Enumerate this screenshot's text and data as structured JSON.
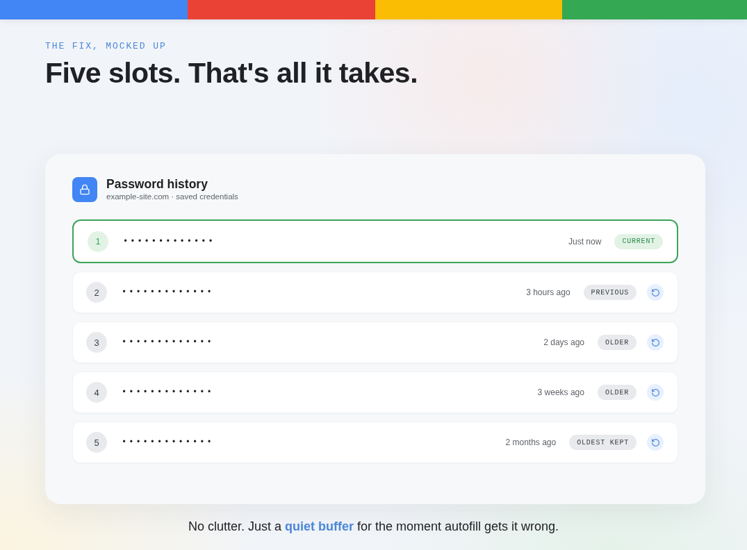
{
  "header": {
    "eyebrow": "THE FIX, MOCKED UP",
    "title": "Five slots. That's all it takes."
  },
  "card": {
    "title": "Password history",
    "subtitle": "example-site.com · saved credentials"
  },
  "rows": [
    {
      "number": "1",
      "password": "•••••••••••••",
      "time": "Just now",
      "badge": "CURRENT",
      "current": true
    },
    {
      "number": "2",
      "password": "•••••••••••••",
      "time": "3 hours ago",
      "badge": "PREVIOUS",
      "current": false
    },
    {
      "number": "3",
      "password": "•••••••••••••",
      "time": "2 days ago",
      "badge": "OLDER",
      "current": false
    },
    {
      "number": "4",
      "password": "•••••••••••••",
      "time": "3 weeks ago",
      "badge": "OLDER",
      "current": false
    },
    {
      "number": "5",
      "password": "•••••••••••••",
      "time": "2 months ago",
      "badge": "OLDEST KEPT",
      "current": false
    }
  ],
  "tagline": "No clutter. Just a **quiet buffer** for the moment autofill gets it wrong."
}
